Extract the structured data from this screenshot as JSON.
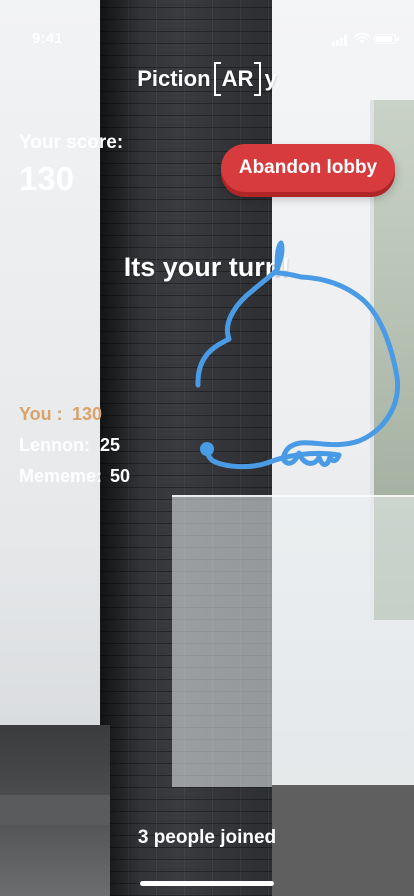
{
  "status_bar": {
    "time": "9:41"
  },
  "app": {
    "title_prefix": "Piction",
    "title_ar": "AR",
    "title_suffix": "y"
  },
  "score": {
    "label": "Your score:",
    "value": "130"
  },
  "abandon_button": {
    "label": "Abandon lobby",
    "color": "#d83b3d"
  },
  "turn_message": "Its your turn!",
  "drawing": {
    "stroke_color": "#4a9be6"
  },
  "leaderboard": [
    {
      "name": "You :",
      "score": "130",
      "is_me": true
    },
    {
      "name": "Lennon:",
      "score": "25",
      "is_me": false
    },
    {
      "name": "Mememe:",
      "score": "50",
      "is_me": false
    }
  ],
  "lobby": {
    "joined_text": "3 people joined"
  }
}
